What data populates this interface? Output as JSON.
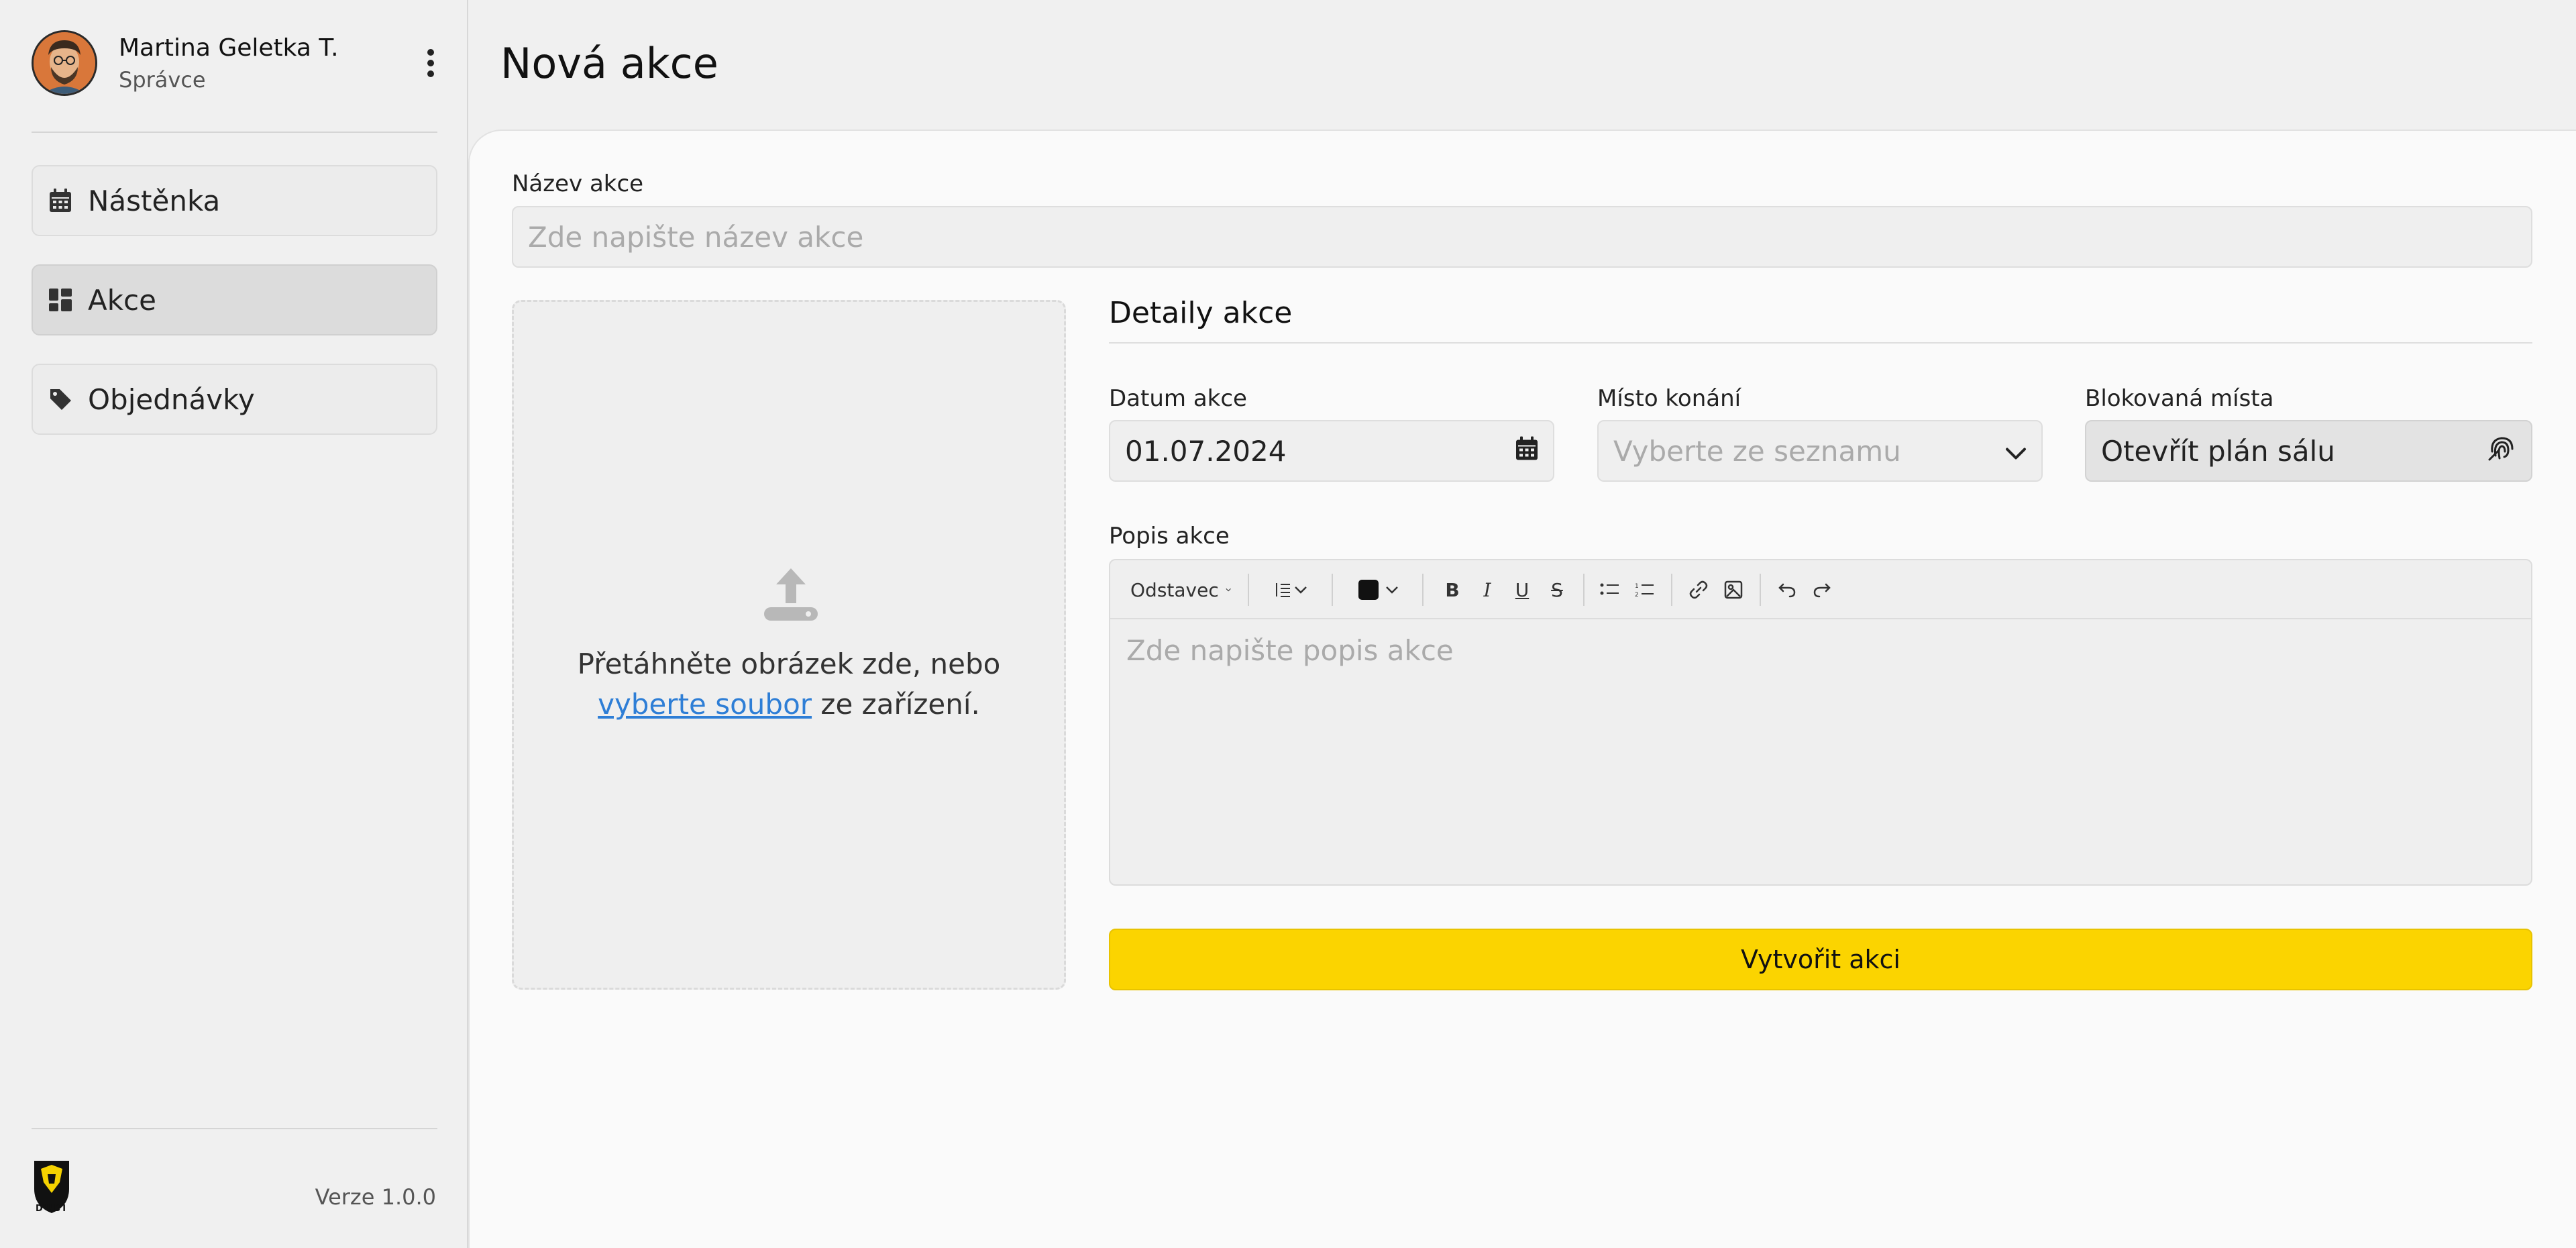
{
  "colors": {
    "accent": "#FBD400",
    "link": "#2E7ED6",
    "sidebar_bg": "#F0F0F0",
    "panel_bg": "#FAFAFA",
    "input_bg": "#EFEFEF"
  },
  "user": {
    "name": "Martina Geletka T.",
    "role": "Správce",
    "avatar_icon": "avatar-illustration",
    "menu_icon": "kebab-menu-icon"
  },
  "sidebar": {
    "items": [
      {
        "label": "Nástěnka",
        "icon": "calendar-icon",
        "active": false
      },
      {
        "label": "Akce",
        "icon": "dashboard-icon",
        "active": true
      },
      {
        "label": "Objednávky",
        "icon": "tag-icon",
        "active": false
      }
    ],
    "version": "Verze 1.0.0",
    "logo_text": "DUBÍ"
  },
  "page": {
    "title": "Nová akce"
  },
  "form": {
    "name_label": "Název akce",
    "name_placeholder": "Zde napište název akce",
    "dropzone": {
      "text_before": "Přetáhněte obrázek zde, nebo",
      "link": "vyberte soubor",
      "text_after": "ze zařízení.",
      "icon": "upload-icon"
    },
    "details_title": "Detaily akce",
    "date_label": "Datum akce",
    "date_value": "01.07.2024",
    "place_label": "Místo konání",
    "place_placeholder": "Vyberte ze seznamu",
    "blocked_label": "Blokovaná místa",
    "blocked_button": "Otevřít plán sálu",
    "description_label": "Popis akce",
    "description_placeholder": "Zde napište popis akce",
    "editor_toolbar": {
      "paragraph_format": "Odstavec",
      "bold": "B",
      "italic": "I",
      "underline": "U",
      "strikethrough": "S"
    },
    "submit_label": "Vytvořit akci"
  }
}
